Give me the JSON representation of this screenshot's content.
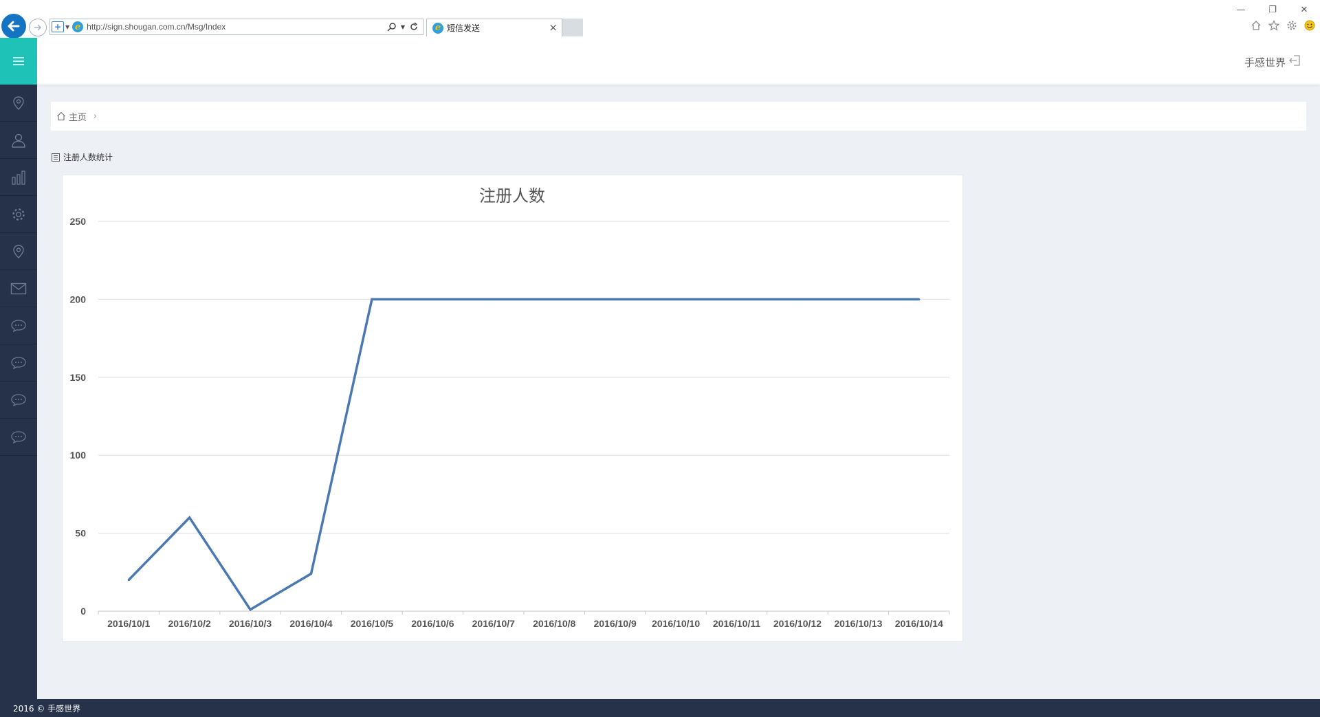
{
  "browser": {
    "url": "http://sign.shougan.com.cn/Msg/Index",
    "tab_title": "短信发送",
    "tab_close": "×",
    "win_minimize": "—",
    "win_restore": "❐",
    "win_close": "✕"
  },
  "header": {
    "user_name": "手感世界"
  },
  "sidebar": {
    "items": [
      {
        "icon": "location-pin-icon"
      },
      {
        "icon": "user-icon"
      },
      {
        "icon": "bar-chart-icon"
      },
      {
        "icon": "gear-icon"
      },
      {
        "icon": "location-pin-icon"
      },
      {
        "icon": "envelope-icon"
      },
      {
        "icon": "chat-bubble-icon"
      },
      {
        "icon": "chat-bubble-icon"
      },
      {
        "icon": "chat-bubble-icon"
      },
      {
        "icon": "chat-bubble-icon"
      }
    ]
  },
  "breadcrumb": {
    "home": "主页",
    "separator": "›"
  },
  "section": {
    "title": "注册人数统计"
  },
  "chart_data": {
    "type": "line",
    "title": "注册人数",
    "xlabel": "",
    "ylabel": "",
    "categories": [
      "2016/10/1",
      "2016/10/2",
      "2016/10/3",
      "2016/10/4",
      "2016/10/5",
      "2016/10/6",
      "2016/10/7",
      "2016/10/8",
      "2016/10/9",
      "2016/10/10",
      "2016/10/11",
      "2016/10/12",
      "2016/10/13",
      "2016/10/14"
    ],
    "series": [
      {
        "values": [
          20,
          60,
          1,
          24,
          200,
          200,
          200,
          200,
          200,
          200,
          200,
          200,
          200,
          200
        ],
        "color": "#4a78b0"
      }
    ],
    "ylim": [
      0,
      250
    ],
    "yticks": [
      0,
      50,
      100,
      150,
      200,
      250
    ],
    "grid": true,
    "legend": "none"
  },
  "footer": {
    "text": "2016 © 手感世界"
  },
  "colors": {
    "accent": "#1ec2b7",
    "sidebar": "#253249",
    "line": "#4a78b0"
  }
}
